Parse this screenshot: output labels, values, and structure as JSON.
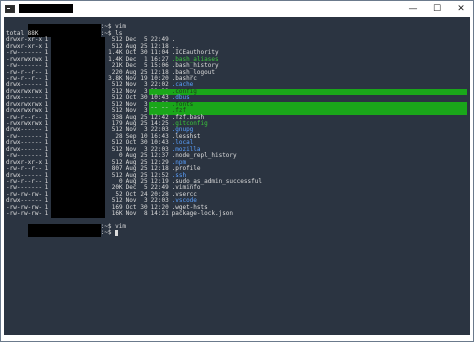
{
  "window": {
    "controls": {
      "minimize": "—",
      "maximize": "☐",
      "close": "✕"
    }
  },
  "prompts": [
    {
      "cmd": "vim"
    },
    {
      "cmd": "ls"
    }
  ],
  "total": "total 88K",
  "listing": [
    {
      "perm": "drwxr-xr-x",
      "links": "1",
      "size": "512",
      "month": "Dec",
      "day": "5",
      "time": "22:49",
      "name": ".",
      "style": "plain"
    },
    {
      "perm": "drwxr-xr-x",
      "links": "1",
      "size": "512",
      "month": "Aug",
      "day": "25",
      "time": "12:18",
      "name": "..",
      "style": "plain"
    },
    {
      "perm": "-rw-------",
      "links": "1",
      "size": "1.4K",
      "month": "Oct",
      "day": "30",
      "time": "11:04",
      "name": ".ICEauthority",
      "style": "plain"
    },
    {
      "perm": "-rwxrwxrwx",
      "links": "1",
      "size": "1.4K",
      "month": "Dec",
      "day": "1",
      "time": "16:27",
      "name": ".bash_aliases",
      "style": "exe"
    },
    {
      "perm": "-rw-------",
      "links": "1",
      "size": "21K",
      "month": "Dec",
      "day": "5",
      "time": "15:06",
      "name": ".bash_history",
      "style": "plain"
    },
    {
      "perm": "-rw-r--r--",
      "links": "1",
      "size": "220",
      "month": "Aug",
      "day": "25",
      "time": "12:18",
      "name": ".bash_logout",
      "style": "plain"
    },
    {
      "perm": "-rw-r--r--",
      "links": "1",
      "size": "3.8K",
      "month": "Nov",
      "day": "19",
      "time": "10:20",
      "name": ".bashrc",
      "style": "plain"
    },
    {
      "perm": "drwx------",
      "links": "1",
      "size": "512",
      "month": "Nov",
      "day": "3",
      "time": "22:02",
      "name": ".cache",
      "style": "dir"
    },
    {
      "perm": "drwxrwxrwx",
      "links": "1",
      "size": "512",
      "month": "Nov",
      "day": "3",
      "time": "22:32",
      "name": ".config",
      "style": "hl"
    },
    {
      "perm": "drwx------",
      "links": "1",
      "size": "512",
      "month": "Oct",
      "day": "30",
      "time": "10:43",
      "name": ".dbus",
      "style": "dir"
    },
    {
      "perm": "drwxrwxrwx",
      "links": "1",
      "size": "512",
      "month": "Nov",
      "day": "3",
      "time": "23:32",
      "name": ".fonts",
      "style": "hl"
    },
    {
      "perm": "drwxrwxrwx",
      "links": "1",
      "size": "512",
      "month": "Nov",
      "day": "3",
      "time": "23:32",
      "name": ".fzf",
      "style": "hl"
    },
    {
      "perm": "-rw-r--r--",
      "links": "1",
      "size": "338",
      "month": "Aug",
      "day": "25",
      "time": "12:42",
      "name": ".fzf.bash",
      "style": "plain"
    },
    {
      "perm": "-rwxrwxrwx",
      "links": "1",
      "size": "179",
      "month": "Aug",
      "day": "25",
      "time": "14:25",
      "name": ".gitconfig",
      "style": "exe"
    },
    {
      "perm": "drwx------",
      "links": "1",
      "size": "512",
      "month": "Nov",
      "day": "3",
      "time": "22:03",
      "name": ".gnupg",
      "style": "dir"
    },
    {
      "perm": "-rw-------",
      "links": "1",
      "size": "28",
      "month": "Sep",
      "day": "10",
      "time": "16:43",
      "name": ".lesshst",
      "style": "plain"
    },
    {
      "perm": "drwx------",
      "links": "1",
      "size": "512",
      "month": "Oct",
      "day": "30",
      "time": "10:43",
      "name": ".local",
      "style": "dir"
    },
    {
      "perm": "drwx------",
      "links": "1",
      "size": "512",
      "month": "Nov",
      "day": "3",
      "time": "22:03",
      "name": ".mozilla",
      "style": "dir"
    },
    {
      "perm": "-rw-------",
      "links": "1",
      "size": "0",
      "month": "Aug",
      "day": "25",
      "time": "12:37",
      "name": ".node_repl_history",
      "style": "plain"
    },
    {
      "perm": "drwxr-xr-x",
      "links": "1",
      "size": "512",
      "month": "Aug",
      "day": "25",
      "time": "12:29",
      "name": ".npm",
      "style": "dir"
    },
    {
      "perm": "-rw-r--r--",
      "links": "1",
      "size": "807",
      "month": "Aug",
      "day": "25",
      "time": "12:18",
      "name": ".profile",
      "style": "plain"
    },
    {
      "perm": "drwx------",
      "links": "1",
      "size": "512",
      "month": "Aug",
      "day": "25",
      "time": "12:52",
      "name": ".ssh",
      "style": "dir"
    },
    {
      "perm": "-rw-r--r--",
      "links": "1",
      "size": "0",
      "month": "Aug",
      "day": "25",
      "time": "12:19",
      "name": ".sudo_as_admin_successful",
      "style": "plain"
    },
    {
      "perm": "-rw-------",
      "links": "1",
      "size": "20K",
      "month": "Dec",
      "day": "5",
      "time": "22:49",
      "name": ".viminfo",
      "style": "plain"
    },
    {
      "perm": "-rw-rw-rw-",
      "links": "1",
      "size": "52",
      "month": "Oct",
      "day": "24",
      "time": "20:28",
      "name": ".vsercc",
      "style": "plain"
    },
    {
      "perm": "drwx------",
      "links": "1",
      "size": "512",
      "month": "Nov",
      "day": "3",
      "time": "22:03",
      "name": ".vscode",
      "style": "dir"
    },
    {
      "perm": "-rw-rw-rw-",
      "links": "1",
      "size": "169",
      "month": "Oct",
      "day": "30",
      "time": "12:20",
      "name": ".wget-hsts",
      "style": "plain"
    },
    {
      "perm": "-rw-rw-rw-",
      "links": "1",
      "size": "16K",
      "month": "Nov",
      "day": "8",
      "time": "14:21",
      "name": "package-lock.json",
      "style": "plain"
    }
  ],
  "after": [
    {
      "cmd": "vim"
    },
    {
      "cmd": ""
    }
  ],
  "colors": {
    "background": "#2b3441",
    "text": "#dcdcdc",
    "highlight": "#1aa61a",
    "directory": "#5aa0ff",
    "executable": "#39c739"
  }
}
